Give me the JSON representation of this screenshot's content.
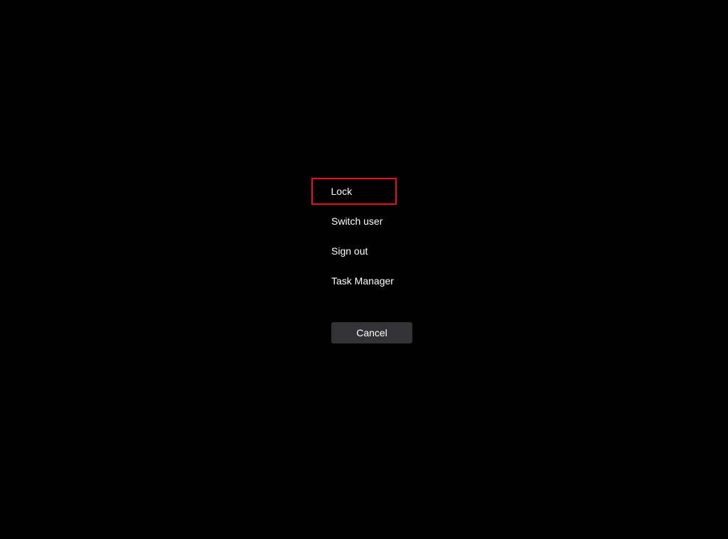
{
  "security_screen": {
    "options": {
      "lock": "Lock",
      "switch_user": "Switch user",
      "sign_out": "Sign out",
      "task_manager": "Task Manager"
    },
    "cancel_label": "Cancel",
    "highlight_color": "#e81123"
  }
}
